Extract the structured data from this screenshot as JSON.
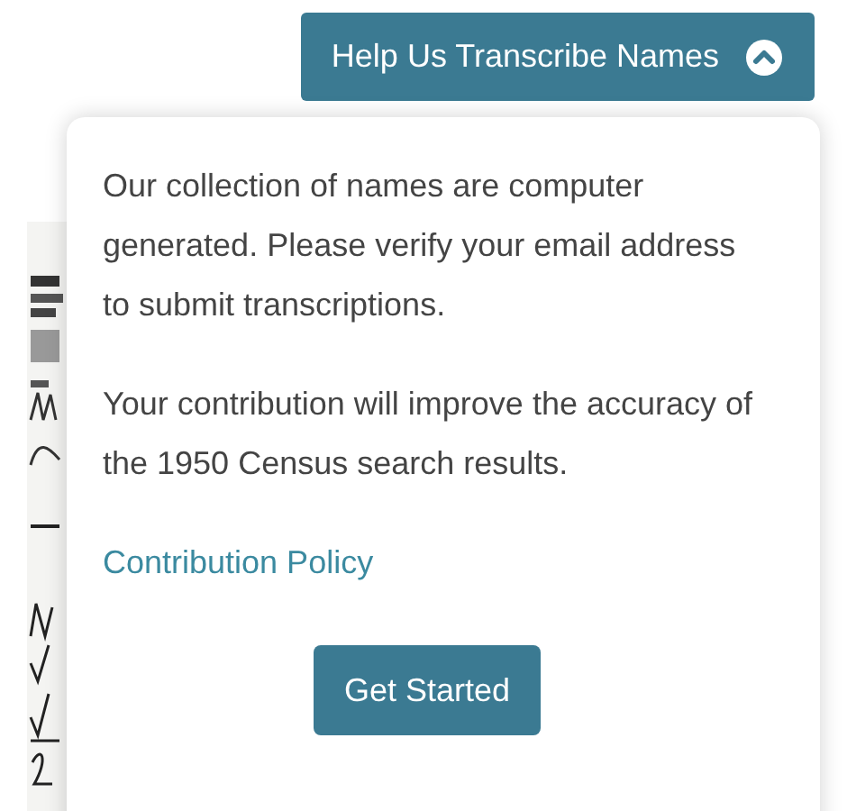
{
  "toggle_button": {
    "label": "Help Us Transcribe Names",
    "expanded": true
  },
  "popover": {
    "paragraphs": [
      "Our collection of names are computer generated. Please verify your email address to submit transcriptions.",
      "Your contribution will improve the accuracy of the 1950 Census search results."
    ],
    "link": "Contribution Policy",
    "button": "Get Started"
  }
}
